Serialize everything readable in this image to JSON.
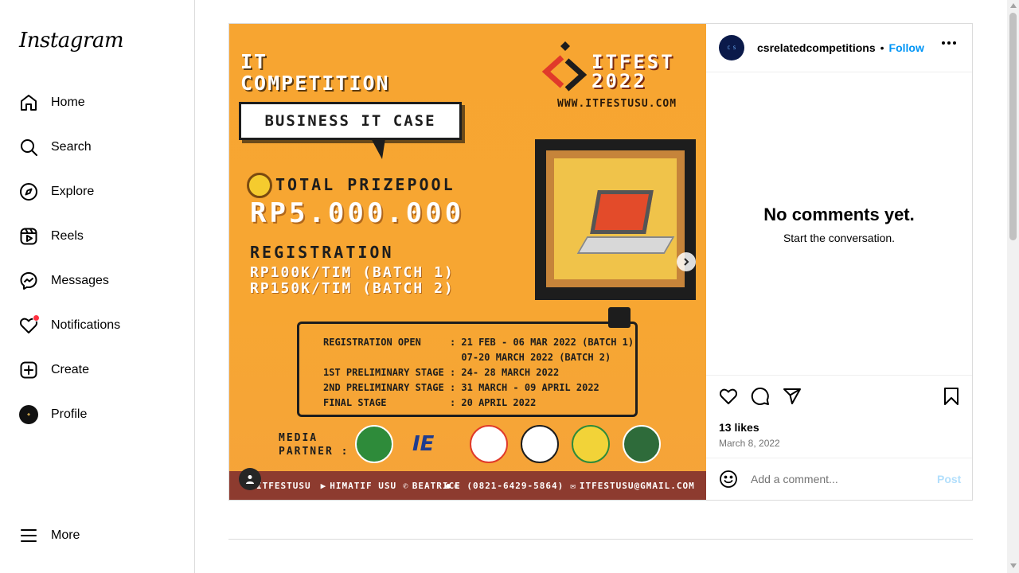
{
  "app": {
    "logo_text": "Instagram"
  },
  "sidebar": {
    "items": [
      {
        "label": "Home",
        "icon": "home-icon"
      },
      {
        "label": "Search",
        "icon": "search-icon"
      },
      {
        "label": "Explore",
        "icon": "compass-icon"
      },
      {
        "label": "Reels",
        "icon": "reels-icon"
      },
      {
        "label": "Messages",
        "icon": "messenger-icon"
      },
      {
        "label": "Notifications",
        "icon": "heart-icon",
        "has_badge_dot": true
      },
      {
        "label": "Create",
        "icon": "plus-square-icon"
      },
      {
        "label": "Profile",
        "icon": "avatar"
      }
    ],
    "more_label": "More"
  },
  "post": {
    "author": {
      "username": "csrelatedcompetitions",
      "separator": "•",
      "follow_label": "Follow"
    },
    "media": {
      "it_title_line1": "IT",
      "it_title_line2": "COMPETITION",
      "bubble_text": "BUSINESS IT CASE",
      "festival_line1": "ITFEST",
      "festival_line2": "2022",
      "website": "WWW.ITFESTUSU.COM",
      "prize_label": "TOTAL PRIZEPOOL",
      "prize_amount": "RP5.000.000",
      "registration_label": "REGISTRATION",
      "batch1_fee": "RP100K/TIM (BATCH 1)",
      "batch2_fee": "RP150K/TIM (BATCH 2)",
      "schedule": [
        "REGISTRATION OPEN     : 21 FEB - 06 MAR 2022 (BATCH 1)",
        "                        07-20 MARCH 2022 (BATCH 2)",
        "1ST PRELIMINARY STAGE : 24- 28 MARCH 2022",
        "2ND PRELIMINARY STAGE : 31 MARCH - 09 APRIL 2022",
        "FINAL STAGE           : 20 APRIL 2022"
      ],
      "media_partner_line1": "MEDIA",
      "media_partner_line2": "PARTNER :",
      "footer_items": [
        "ITFESTUSU",
        "HIMATIF USU",
        "BEATRICE (0821-6429-5864)",
        "ITFESTUSU@GMAIL.COM"
      ],
      "carousel_dots": 2,
      "active_dot": 0
    },
    "empty_comments_title": "No comments yet.",
    "empty_comments_subtitle": "Start the conversation.",
    "likes": "13 likes",
    "date": "March 8, 2022",
    "comment_placeholder": "Add a comment...",
    "post_label": "Post"
  },
  "colors": {
    "accent": "#0095f6",
    "poster_orange": "#f7a531",
    "footer_bar": "#8d3b2f",
    "notification_dot": "#ff3040"
  }
}
